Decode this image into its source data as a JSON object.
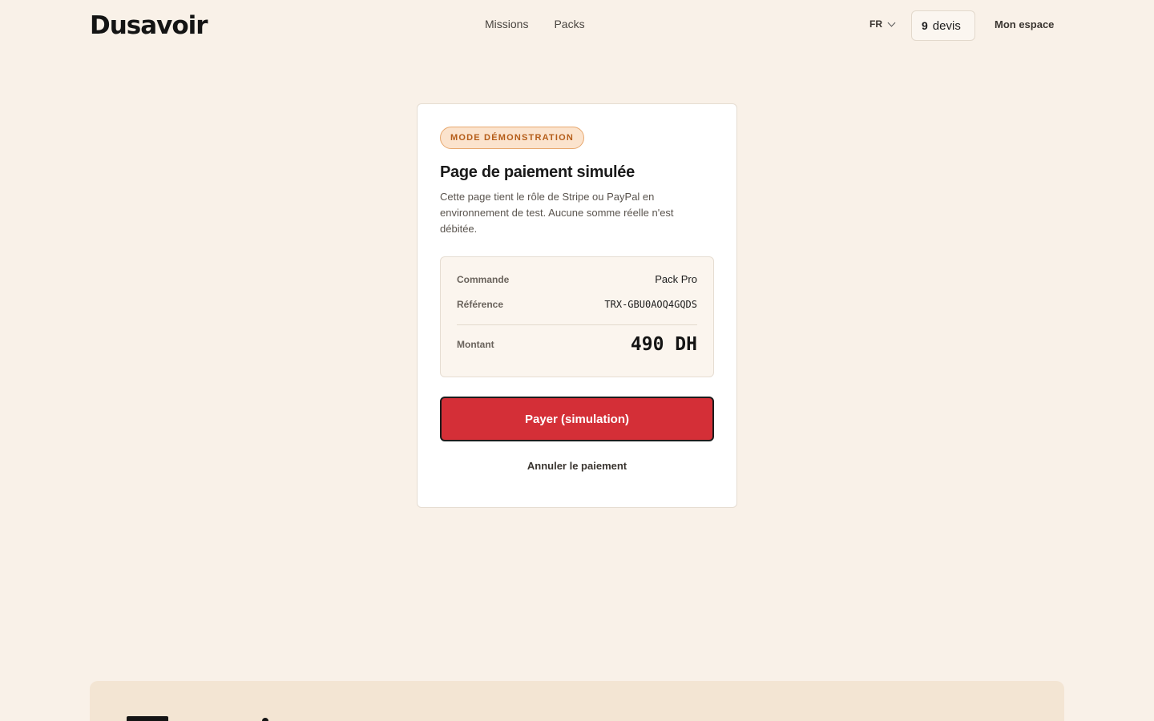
{
  "header": {
    "logo": "Dusavoir",
    "nav": [
      "Missions",
      "Packs"
    ],
    "lang": "FR",
    "devis_count": "9",
    "devis_label": "devis",
    "account": "Mon espace"
  },
  "card": {
    "badge": "MODE DÉMONSTRATION",
    "title": "Page de paiement simulée",
    "description": "Cette page tient le rôle de Stripe ou PayPal en environnement de test. Aucune somme réelle n'est débitée.",
    "summary": {
      "order_label": "Commande",
      "order_value": "Pack Pro",
      "ref_label": "Référence",
      "ref_value": "TRX-GBU0AOQ4GQDS",
      "amount_label": "Montant",
      "amount_value": "490 DH"
    },
    "pay_button": "Payer (simulation)",
    "cancel_link": "Annuler le paiement"
  },
  "colors": {
    "background": "#f9f1e8",
    "accent": "#d42f37",
    "badge_bg": "#fbe3cd",
    "badge_text": "#b55d19"
  }
}
